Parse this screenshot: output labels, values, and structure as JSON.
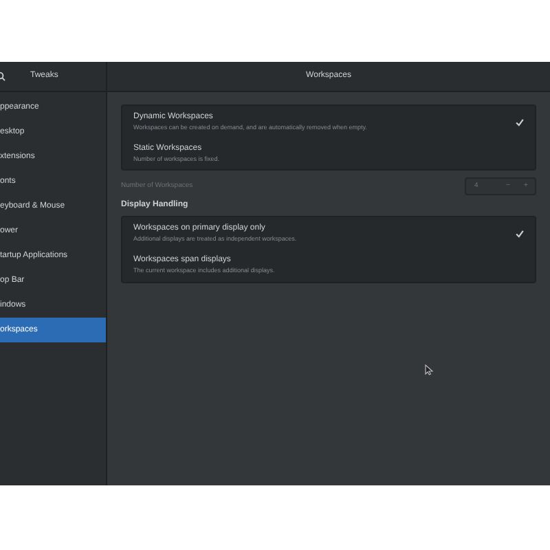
{
  "header": {
    "app_title": "Tweaks",
    "page_title": "Workspaces"
  },
  "sidebar": {
    "items": [
      {
        "label": "ppearance",
        "selected": false
      },
      {
        "label": "esktop",
        "selected": false
      },
      {
        "label": "xtensions",
        "selected": false
      },
      {
        "label": "onts",
        "selected": false
      },
      {
        "label": "eyboard & Mouse",
        "selected": false
      },
      {
        "label": "ower",
        "selected": false
      },
      {
        "label": "tartup Applications",
        "selected": false
      },
      {
        "label": "op Bar",
        "selected": false
      },
      {
        "label": "indows",
        "selected": false
      },
      {
        "label": "orkspaces",
        "selected": true
      }
    ]
  },
  "workspace_mode": {
    "options": [
      {
        "title": "Dynamic Workspaces",
        "description": "Workspaces can be created on demand, and are automatically removed when empty.",
        "selected": true
      },
      {
        "title": "Static Workspaces",
        "description": "Number of workspaces is fixed.",
        "selected": false
      }
    ]
  },
  "number_of_workspaces": {
    "label": "Number of Workspaces",
    "value": "4",
    "decrement": "−",
    "increment": "+",
    "disabled": true
  },
  "display_handling": {
    "heading": "Display Handling",
    "options": [
      {
        "title": "Workspaces on primary display only",
        "description": "Additional displays are treated as independent workspaces.",
        "selected": true
      },
      {
        "title": "Workspaces span displays",
        "description": "The current workspace includes additional displays.",
        "selected": false
      }
    ]
  }
}
